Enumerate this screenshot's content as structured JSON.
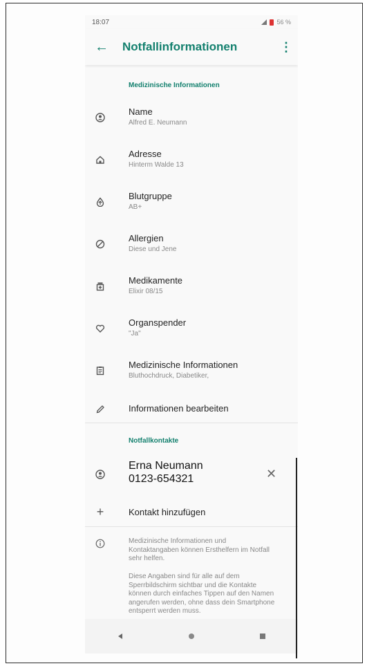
{
  "status": {
    "time": "18:07",
    "battery": "56 %"
  },
  "appbar": {
    "title": "Notfallinformationen"
  },
  "medical": {
    "section_title": "Medizinische Informationen",
    "items": [
      {
        "label": "Name",
        "value": "Alfred E. Neumann",
        "icon": "person-icon"
      },
      {
        "label": "Adresse",
        "value": "Hinterm Walde 13",
        "icon": "home-icon"
      },
      {
        "label": "Blutgruppe",
        "value": "AB+",
        "icon": "blood-drop-icon"
      },
      {
        "label": "Allergien",
        "value": "Diese und Jene",
        "icon": "block-icon"
      },
      {
        "label": "Medikamente",
        "value": "Elixir 08/15",
        "icon": "medication-icon"
      },
      {
        "label": "Organspender",
        "value": "\"Ja\"",
        "icon": "heart-icon"
      },
      {
        "label": "Medizinische Informationen",
        "value": "Bluthochdruck, Diabetiker,",
        "icon": "clipboard-icon"
      }
    ],
    "edit_label": "Informationen bearbeiten"
  },
  "contacts": {
    "section_title": "Notfallkontakte",
    "contact": {
      "name": "Erna Neumann",
      "phone": "0123-654321"
    },
    "add_label": "Kontakt hinzufügen"
  },
  "info": {
    "paragraph1": "Medizinische Informationen und Kontaktangaben können Ersthelfern im Notfall sehr helfen.",
    "paragraph2": "Diese Angaben sind für alle auf dem Sperrbildschirm sichtbar und die Kontakte können durch einfaches Tippen auf den Namen angerufen werden, ohne dass dein Smartphone entsperrt werden muss."
  },
  "colors": {
    "accent": "#13806e",
    "text": "#222222",
    "secondary": "#888888"
  }
}
